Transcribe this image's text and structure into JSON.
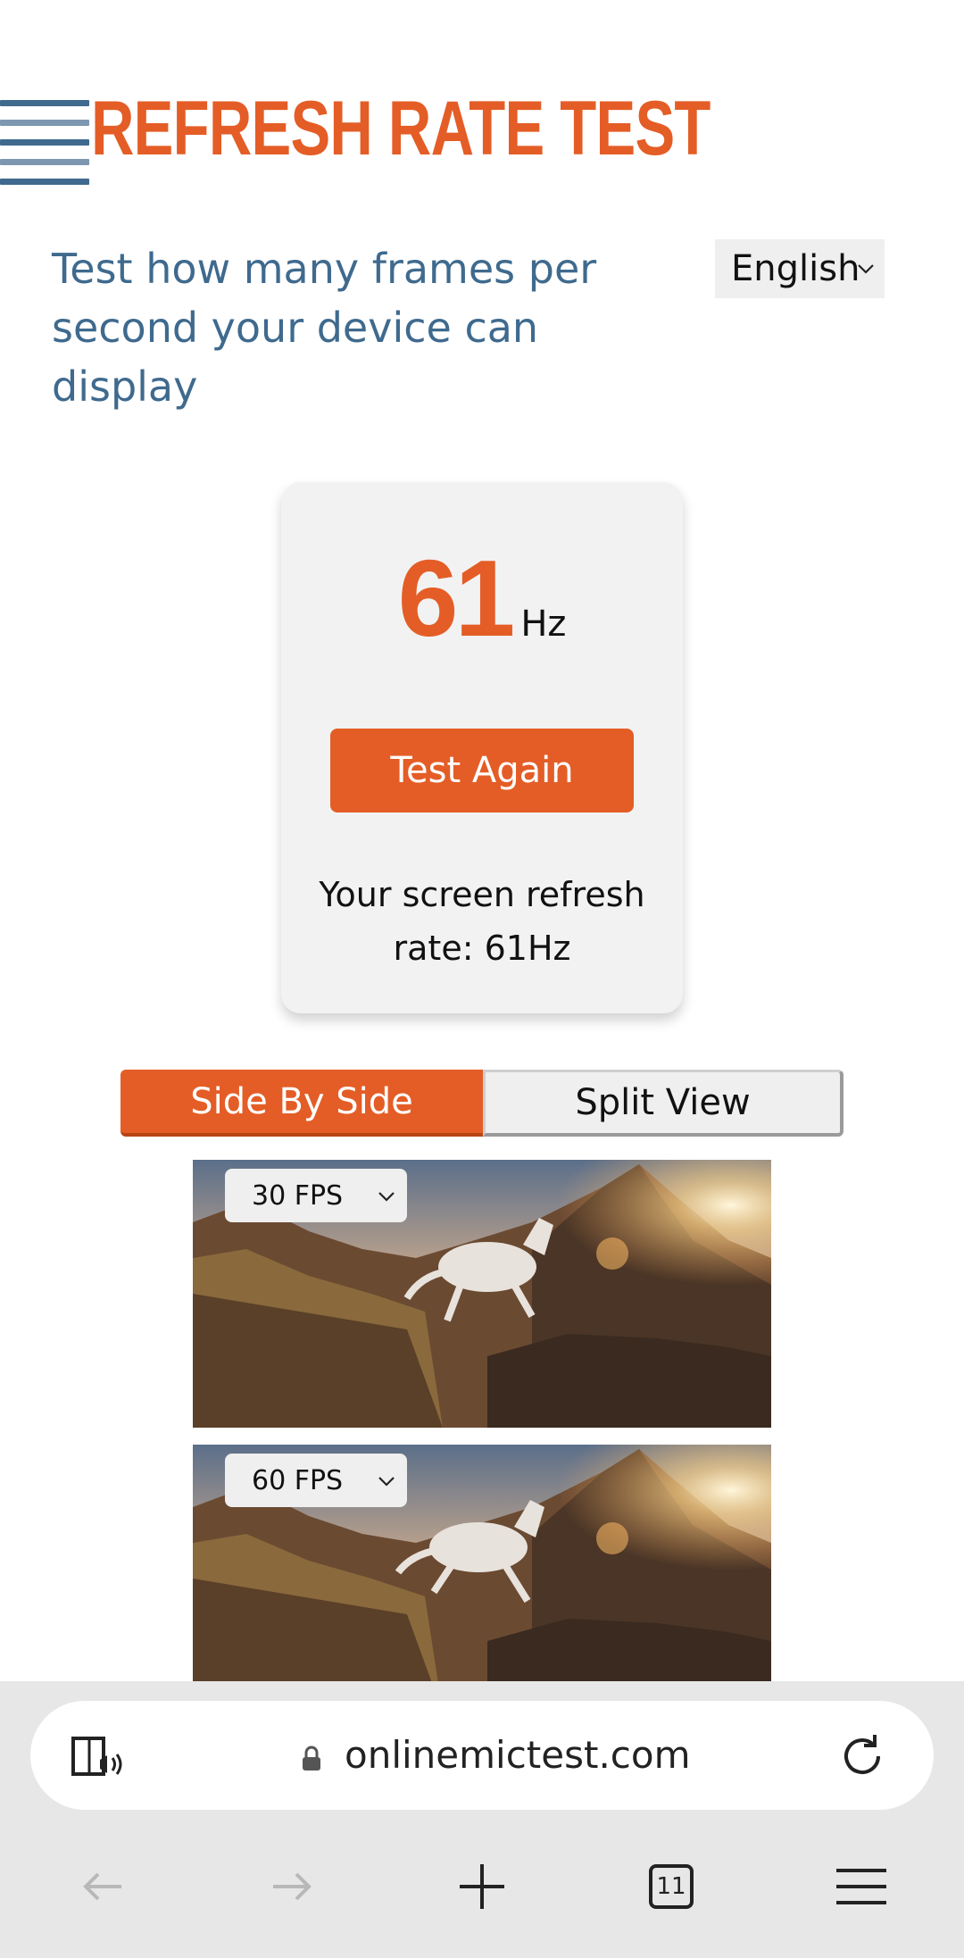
{
  "header": {
    "title": "REFRESH RATE TEST",
    "subtitle": "Test how many frames per second your device can display",
    "language": "English"
  },
  "result": {
    "hz_value": "61",
    "hz_unit": "Hz",
    "test_again_label": "Test Again",
    "summary": "Your screen refresh rate: 61Hz"
  },
  "view_toggle": {
    "side_by_side_label": "Side By Side",
    "split_view_label": "Split View",
    "active": "Side By Side"
  },
  "videos": [
    {
      "fps_label": "30 FPS"
    },
    {
      "fps_label": "60 FPS"
    }
  ],
  "browser": {
    "url": "onlinemictest.com",
    "tab_count": "11"
  },
  "colors": {
    "accent": "#e45d26",
    "subtitle": "#3f6a8e"
  }
}
